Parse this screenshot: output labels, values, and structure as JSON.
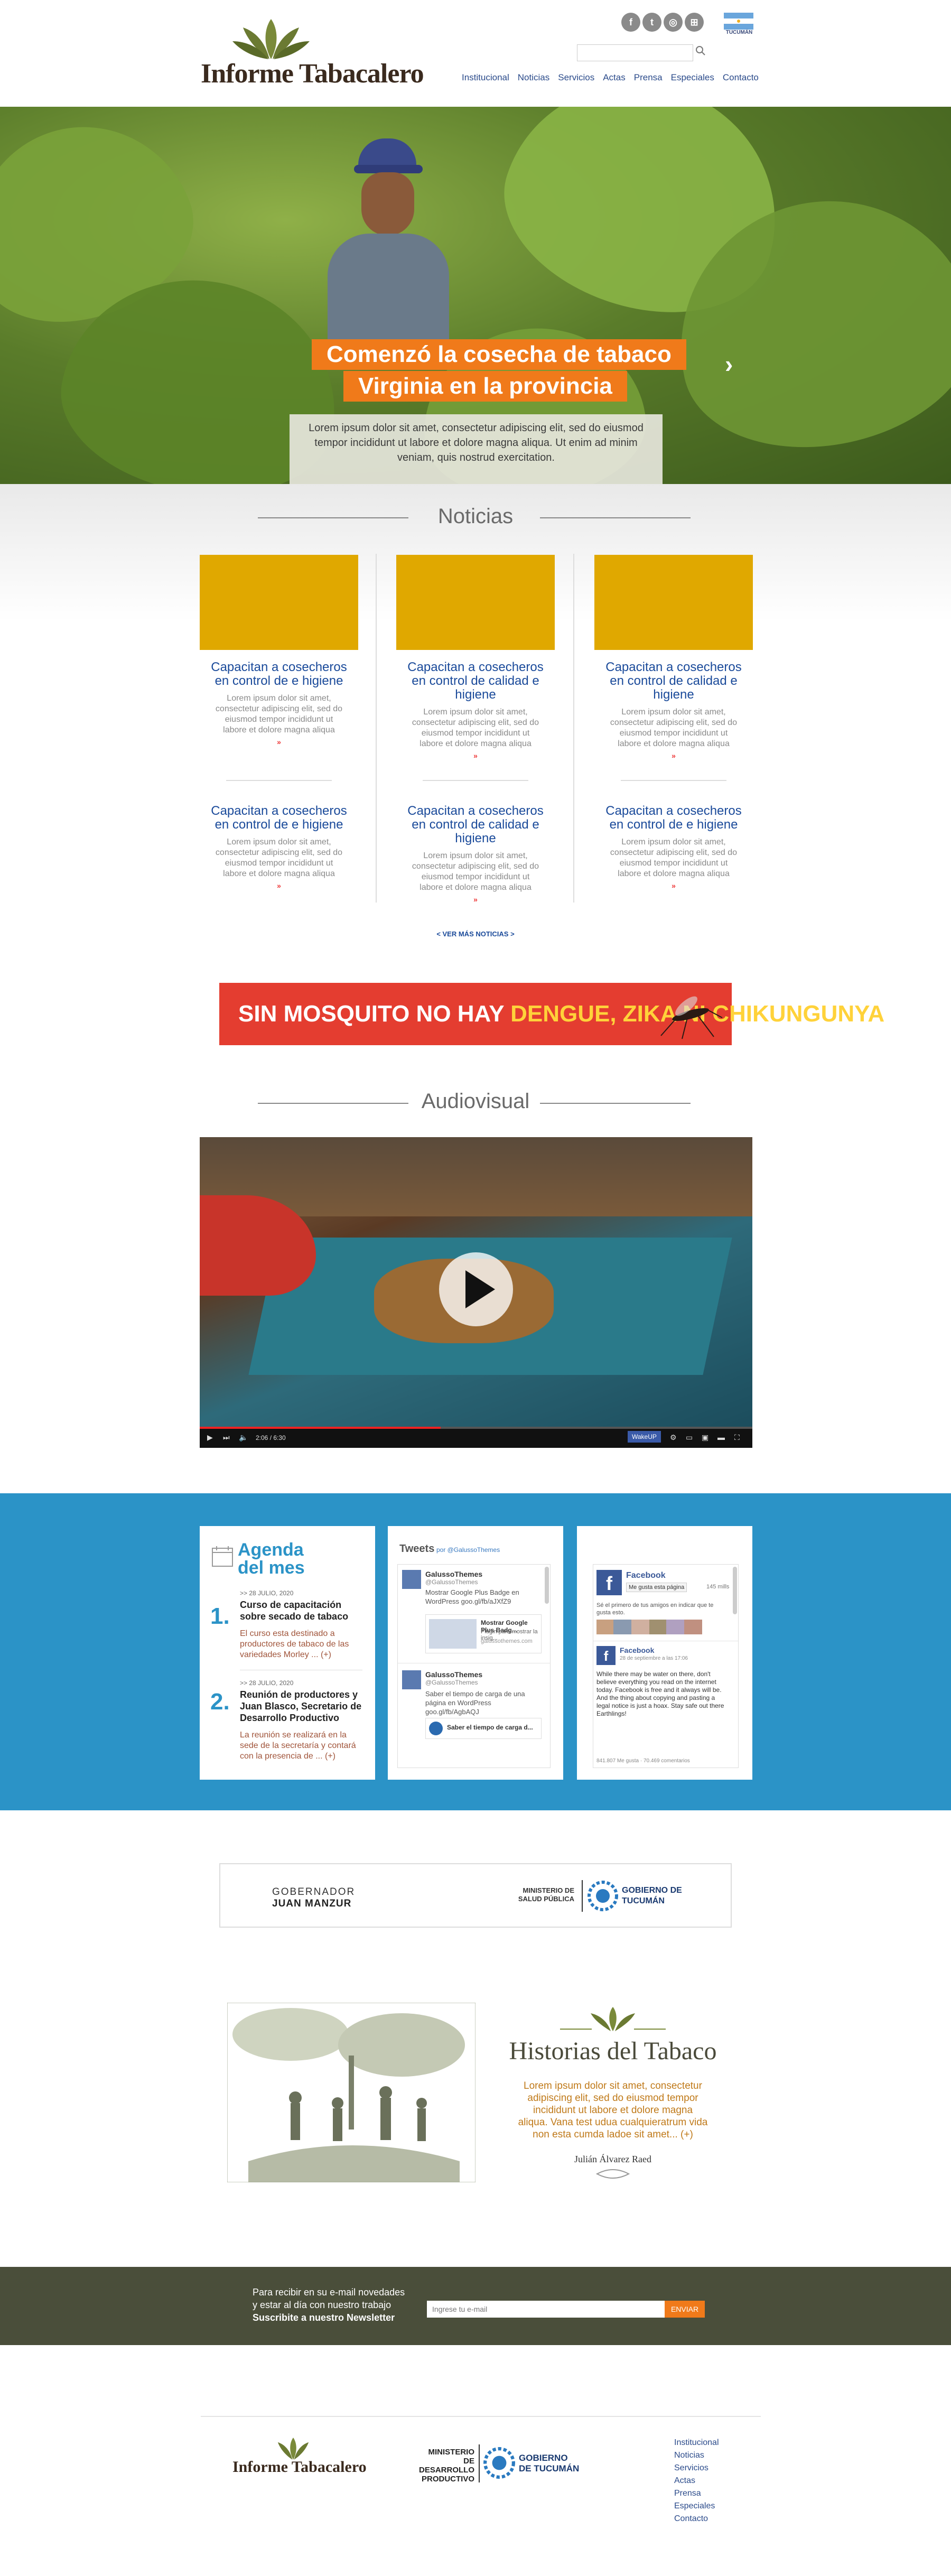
{
  "header": {
    "logo_text": "Informe Tabacalero",
    "social": [
      "f",
      "t",
      "◎",
      "⊞"
    ],
    "flag_label": "TUCUMÁN",
    "nav": [
      "Institucional",
      "Noticias",
      "Servicios",
      "Actas",
      "Prensa",
      "Especiales",
      "Contacto"
    ]
  },
  "hero": {
    "title_line1": "Comenzó la cosecha de tabaco",
    "title_line2": "Virginia en la provincia",
    "caption": "Lorem ipsum dolor sit amet, consectetur adipiscing elit, sed do eiusmod tempor incididunt ut labore et dolore magna aliqua. Ut enim ad minim veniam, quis nostrud exercitation."
  },
  "news": {
    "section_title": "Noticias",
    "items": [
      {
        "title": "Capacitan a cosecheros en control de  e higiene",
        "text": "Lorem ipsum dolor sit amet, consectetur adipiscing elit, sed do eiusmod tempor incididunt ut labore et dolore magna aliqua",
        "more": "»"
      },
      {
        "title": "Capacitan a cosecheros en control de calidad e higiene",
        "text": "Lorem ipsum dolor sit amet, consectetur adipiscing elit, sed do eiusmod tempor incididunt ut labore et dolore magna aliqua",
        "more": "»"
      },
      {
        "title": "Capacitan a cosecheros en control de calidad e higiene",
        "text": "Lorem ipsum dolor sit amet, consectetur adipiscing elit, sed do eiusmod tempor incididunt ut labore et dolore magna aliqua",
        "more": "»"
      },
      {
        "title": "Capacitan a cosecheros en control de  e higiene",
        "text": "Lorem ipsum dolor sit amet, consectetur adipiscing elit, sed do eiusmod tempor incididunt ut labore et dolore magna aliqua",
        "more": "»"
      },
      {
        "title": "Capacitan a cosecheros en control de calidad e higiene",
        "text": "Lorem ipsum dolor sit amet, consectetur adipiscing elit, sed do eiusmod tempor incididunt ut labore et dolore magna aliqua",
        "more": "»"
      },
      {
        "title": "Capacitan a cosecheros en control de  e higiene",
        "text": "Lorem ipsum dolor sit amet, consectetur adipiscing elit, sed do eiusmod tempor incididunt ut labore et dolore magna aliqua",
        "more": "»"
      }
    ],
    "ver_mas": "< VER MÁS NOTICIAS >"
  },
  "banner": {
    "text_white": "SIN MOSQUITO NO HAY ",
    "text_yellow": "DENGUE, ZIKA NI CHIKUNGUNYA"
  },
  "video": {
    "section_title": "Audiovisual",
    "time": "2:06 / 6:30",
    "brand": "WakeUP",
    "progress": 0.436
  },
  "agenda": {
    "title_line1": "Agenda",
    "title_line2": "del mes",
    "items": [
      {
        "num": "1.",
        "date": ">> 28 JULIO, 2020",
        "head": "Curso de capacitación sobre secado de tabaco",
        "body": "El curso esta destinado a productores de tabaco de las variedades Morley ... (+)"
      },
      {
        "num": "2.",
        "date": ">> 28 JULIO, 2020",
        "head": "Reunión de productores y Juan Blasco, Secretario de Desarrollo Productivo",
        "body": "La reunión se realizará en la sede de la secretaría y contará con la presencia de ... (+)"
      }
    ]
  },
  "tweets": {
    "title": "Tweets",
    "by": "por @GalussoThemes",
    "items": [
      {
        "name": "GalussoThemes",
        "handle": "@GalussoThemes",
        "text": "Mostrar Google Plus Badge en WordPress goo.gl/fb/aJXfZ9",
        "card_title": "Mostrar Google Plus Badg...",
        "card_text": "Plugin para mostrar la insig...",
        "card_url": "galussothemes.com"
      },
      {
        "name": "GalussoThemes",
        "handle": "@GalussoThemes",
        "text": "Saber el tiempo de carga de una página en WordPress goo.gl/fb/AgbAQJ",
        "card_title": "Saber el tiempo de carga d...",
        "card_text": "",
        "card_url": ""
      }
    ]
  },
  "facebook": {
    "page": "Facebook",
    "like": "Me gusta esta página",
    "likes": "145 mills",
    "friends": "Sé el primero de tus amigos en indicar que te gusta esto.",
    "post_title": "Facebook",
    "post_date": "28 de septiembre a las 17:06",
    "post_text": "While there may be water on there, don't believe everything you read on the internet today. Facebook is free and it always will be. And the thing about copying and pasting a legal notice is just a hoax. Stay safe out there Earthlings!",
    "post_stats": "841.807 Me gusta · 70.469 comentarios"
  },
  "gov": {
    "gobernador_label": "GOBERNADOR",
    "gobernador_name": "JUAN MANZUR",
    "ministerio": "MINISTERIO DE SALUD PÚBLICA",
    "gobierno": "GOBIERNO DE TUCUMÁN"
  },
  "historias": {
    "title": "Historias del Tabaco",
    "text": "Lorem ipsum dolor sit amet, consectetur adipiscing elit, sed do eiusmod tempor incididunt ut labore et dolore magna aliqua. Vana test udua cualquieratrum vida non esta cumda ladoe sit amet... (+)",
    "author": "Julián Álvarez Raed"
  },
  "newsletter": {
    "line1": "Para recibir en su e-mail novedades",
    "line2": "y estar al día con nuestro trabajo",
    "line3": "Suscribite a nuestro Newsletter",
    "placeholder": "Ingrese tu e-mail",
    "button": "ENVIAR"
  },
  "footer": {
    "logo_text": "Informe Tabacalero",
    "ministerio": "MINISTERIO DE DESARROLLO PRODUCTIVO",
    "gobierno": "GOBIERNO DE TUCUMÁN",
    "links": [
      "Institucional",
      "Noticias",
      "Servicios",
      "Actas",
      "Prensa",
      "Especiales",
      "Contacto"
    ]
  },
  "colors": {
    "accent_orange": "#f07a1a",
    "news_yellow": "#e0a800",
    "band_blue": "#2b93c7",
    "banner_red": "#e43d30",
    "newsletter_olive": "#4a4e3a"
  }
}
